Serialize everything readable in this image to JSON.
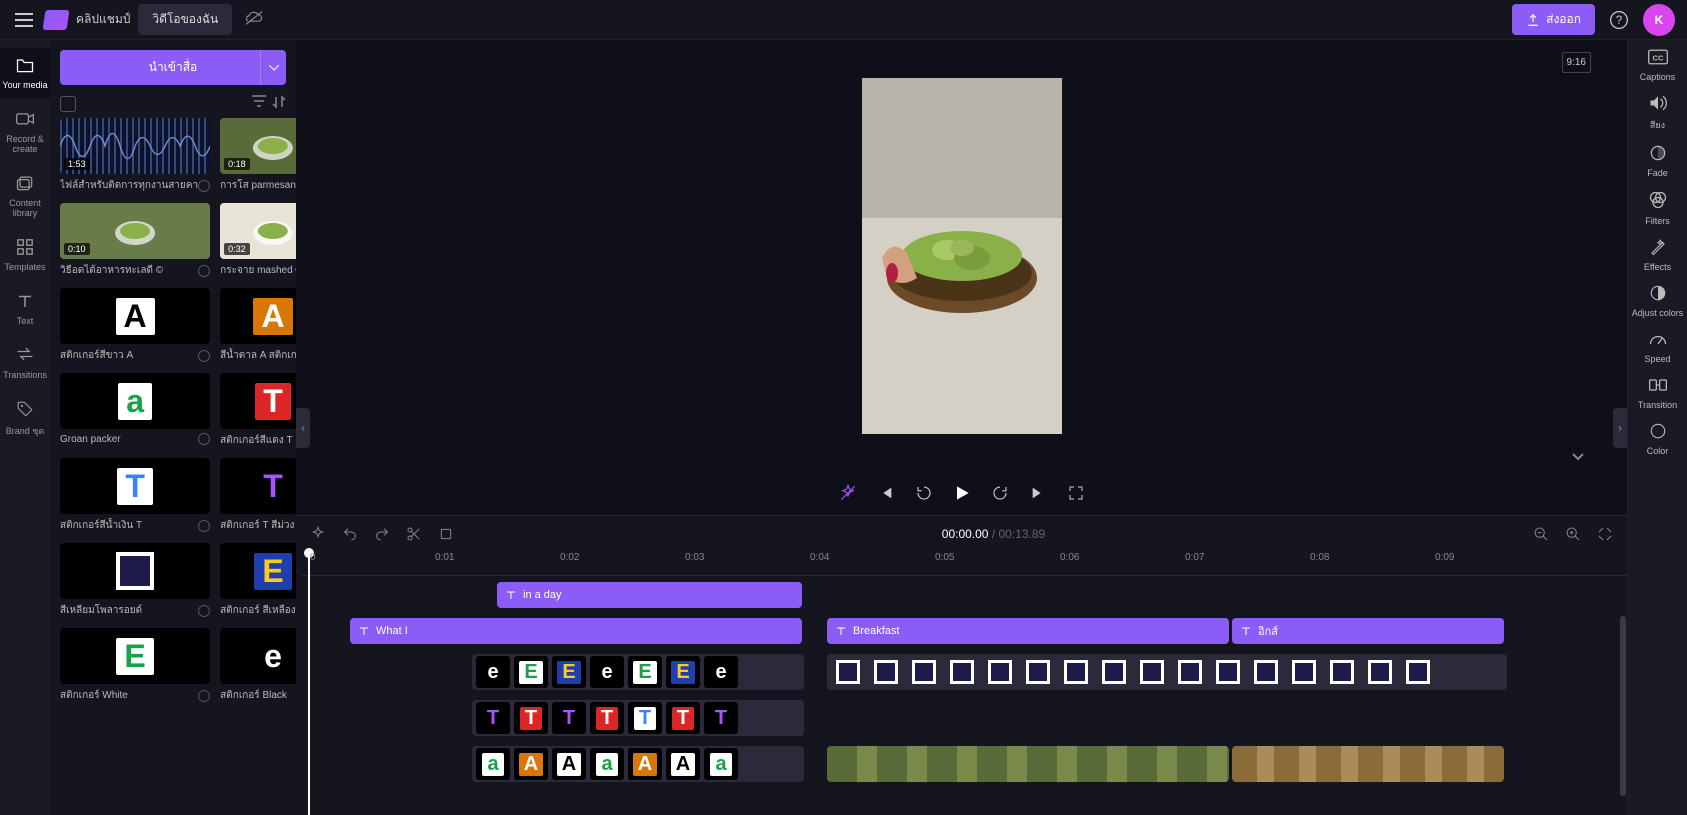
{
  "topbar": {
    "app_name": "คลิปแชมป์",
    "my_videos": "วิดีโอของฉัน",
    "export": "ส่งออก",
    "avatar_letter": "K"
  },
  "leftnav": [
    {
      "id": "your-media",
      "label": "Your media",
      "icon": "folder",
      "active": true
    },
    {
      "id": "record-create",
      "label": "Record & create",
      "icon": "camera"
    },
    {
      "id": "content-library",
      "label": "Content library",
      "icon": "library"
    },
    {
      "id": "templates",
      "label": "Templates",
      "icon": "grid"
    },
    {
      "id": "text",
      "label": "Text",
      "icon": "text"
    },
    {
      "id": "transitions",
      "label": "Transitions",
      "icon": "swap"
    },
    {
      "id": "brand",
      "label": "Brand ชุด",
      "icon": "tag"
    }
  ],
  "media_panel": {
    "import_label": "นำเข้าสื่อ"
  },
  "media_items": [
    {
      "kind": "audio",
      "duration": "1:53",
      "label": "ไฟล์สำหรับติดการทุกงานสายคา"
    },
    {
      "kind": "video",
      "duration": "0:18",
      "label": "การโส parmesanc. ©",
      "bg": "#5a6b3a"
    },
    {
      "kind": "video",
      "duration": "0:10",
      "label": "วิธีอดได้อาหารทะเลดี ©",
      "bg": "#6a7b4a"
    },
    {
      "kind": "video",
      "duration": "0:32",
      "label": "กระจาย mashed ©",
      "bg": "#e8e4d8"
    },
    {
      "kind": "letter",
      "letter": "A",
      "fg": "#000",
      "bg_box": "#fff",
      "label": "สติกเกอร์สีขาว A"
    },
    {
      "kind": "letter",
      "letter": "A",
      "fg": "#fff",
      "bg_box": "#d97706",
      "label": "สีน้ำตาล A สติกเกอร์"
    },
    {
      "kind": "letter",
      "letter": "a",
      "fg": "#16a34a",
      "bg_box": "#fff",
      "label": "Groan packer"
    },
    {
      "kind": "letter",
      "letter": "T",
      "fg": "#fff",
      "bg_box": "#dc2626",
      "label": "สติกเกอร์สีแดง T"
    },
    {
      "kind": "letter",
      "letter": "T",
      "fg": "#3b82f6",
      "bg_box": "#fff",
      "label": "สติกเกอร์สีน้ำเงิน T"
    },
    {
      "kind": "letter",
      "letter": "T",
      "fg": "#a855f7",
      "bg_box": "#000",
      "label": "สติกเกอร์ T สีม่วง"
    },
    {
      "kind": "letter",
      "letter": "",
      "fg": "",
      "bg_box": "#fff",
      "frame": "#1e1b4b",
      "label": "สีเหลียมโพลารอยด์"
    },
    {
      "kind": "letter",
      "letter": "E",
      "fg": "#facc15",
      "bg_box": "#1e40af",
      "label": "สติกเกอร์ สีเหลือง"
    },
    {
      "kind": "letter",
      "letter": "E",
      "fg": "#16a34a",
      "bg_box": "#fff",
      "label": "สติกเกอร์ White"
    },
    {
      "kind": "letter",
      "letter": "e",
      "fg": "#fff",
      "bg_box": "#000",
      "label": "สติกเกอร์ Black"
    }
  ],
  "preview": {
    "ratio": "9:16"
  },
  "player": {
    "current_time": "00:00.00",
    "total_time": "00:13.89"
  },
  "ruler_ticks": [
    "0",
    "0:01",
    "0:02",
    "0:03",
    "0:04",
    "0:05",
    "0:06",
    "0:07",
    "0:08",
    "0:09"
  ],
  "clips": {
    "in_a_day": "in a day",
    "what_i": "What I",
    "breakfast": "Breakfast",
    "eggs": "อิกส์"
  },
  "e_tiles": [
    {
      "letter": "e",
      "fg": "#fff",
      "bg": "#000"
    },
    {
      "letter": "E",
      "fg": "#16a34a",
      "bg": "#fff"
    },
    {
      "letter": "E",
      "fg": "#facc15",
      "bg": "#1e40af"
    },
    {
      "letter": "e",
      "fg": "#fff",
      "bg": "#000"
    },
    {
      "letter": "E",
      "fg": "#16a34a",
      "bg": "#fff"
    },
    {
      "letter": "E",
      "fg": "#facc15",
      "bg": "#1e40af"
    },
    {
      "letter": "e",
      "fg": "#fff",
      "bg": "#000"
    }
  ],
  "t_tiles": [
    {
      "letter": "T",
      "fg": "#a855f7",
      "bg": "#000"
    },
    {
      "letter": "T",
      "fg": "#fff",
      "bg": "#dc2626"
    },
    {
      "letter": "T",
      "fg": "#a855f7",
      "bg": "#000"
    },
    {
      "letter": "T",
      "fg": "#fff",
      "bg": "#dc2626"
    },
    {
      "letter": "T",
      "fg": "#3b82f6",
      "bg": "#fff"
    },
    {
      "letter": "T",
      "fg": "#fff",
      "bg": "#dc2626"
    },
    {
      "letter": "T",
      "fg": "#a855f7",
      "bg": "#000"
    }
  ],
  "a_tiles": [
    {
      "letter": "a",
      "fg": "#16a34a",
      "bg": "#fff"
    },
    {
      "letter": "A",
      "fg": "#fff",
      "bg": "#d97706"
    },
    {
      "letter": "A",
      "fg": "#000",
      "bg": "#fff"
    },
    {
      "letter": "a",
      "fg": "#16a34a",
      "bg": "#fff"
    },
    {
      "letter": "A",
      "fg": "#fff",
      "bg": "#d97706"
    },
    {
      "letter": "A",
      "fg": "#000",
      "bg": "#fff"
    },
    {
      "letter": "a",
      "fg": "#16a34a",
      "bg": "#fff"
    }
  ],
  "rightnav": [
    {
      "id": "captions",
      "label": "Captions",
      "icon": "cc"
    },
    {
      "id": "audio",
      "label": "สียง",
      "icon": "speaker"
    },
    {
      "id": "fade",
      "label": "Fade",
      "icon": "fade"
    },
    {
      "id": "filters",
      "label": "Filters",
      "icon": "filters"
    },
    {
      "id": "effects",
      "label": "Effects",
      "icon": "wand"
    },
    {
      "id": "adjust",
      "label": "Adjust colors",
      "icon": "contrast"
    },
    {
      "id": "speed",
      "label": "Speed",
      "icon": "gauge"
    },
    {
      "id": "transition",
      "label": "Transition",
      "icon": "swap2"
    },
    {
      "id": "color",
      "label": "Color",
      "icon": "circle"
    }
  ]
}
